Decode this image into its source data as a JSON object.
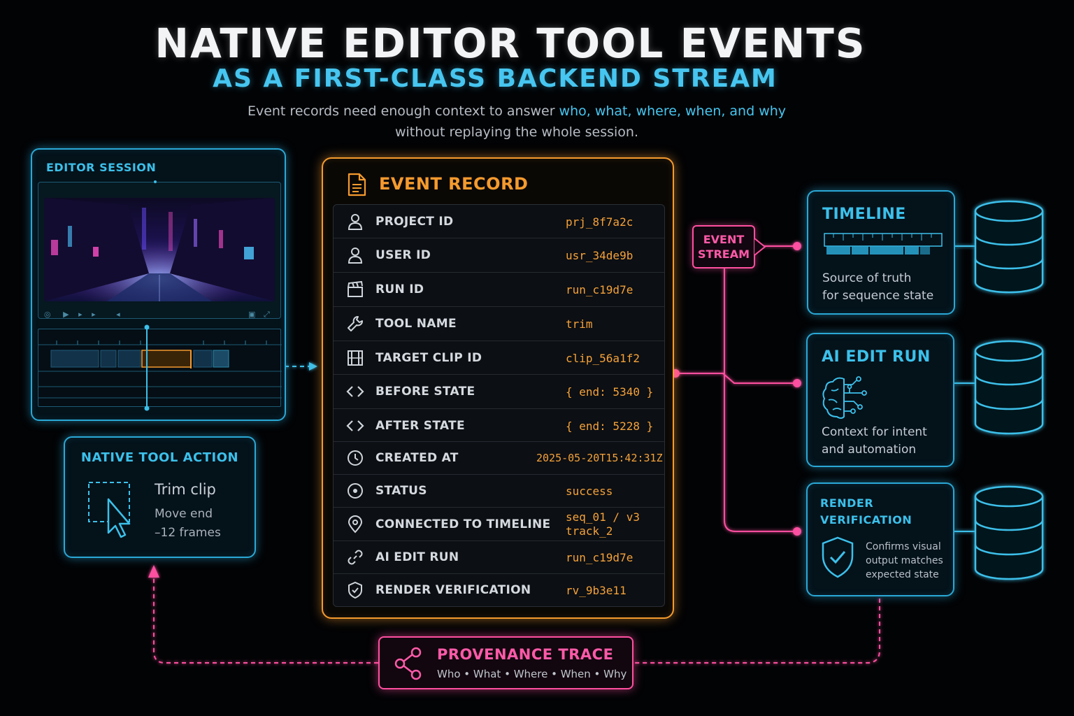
{
  "header": {
    "title": "NATIVE EDITOR TOOL EVENTS",
    "subtitle": "AS A FIRST-CLASS BACKEND STREAM",
    "desc_line1_a": "Event records need enough context to answer ",
    "desc_line1_b": "who, what, where, when, and why",
    "desc_line2": "without replaying the whole session."
  },
  "editor_session": {
    "label": "EDITOR SESSION"
  },
  "native_tool_action": {
    "label": "NATIVE TOOL ACTION",
    "action": "Trim clip",
    "detail_line1": "Move end",
    "detail_line2": "–12 frames"
  },
  "event_record": {
    "title": "EVENT RECORD",
    "rows": [
      {
        "icon": "user-icon",
        "label": "PROJECT ID",
        "value": "prj_8f7a2c"
      },
      {
        "icon": "user-icon",
        "label": "USER ID",
        "value": "usr_34de9b"
      },
      {
        "icon": "clapperboard-icon",
        "label": "RUN ID",
        "value": "run_c19d7e"
      },
      {
        "icon": "wrench-icon",
        "label": "TOOL NAME",
        "value": "trim"
      },
      {
        "icon": "film-icon",
        "label": "TARGET CLIP ID",
        "value": "clip_56a1f2"
      },
      {
        "icon": "code-icon",
        "label": "BEFORE STATE",
        "value": "{ end: 5340 }"
      },
      {
        "icon": "code-icon",
        "label": "AFTER STATE",
        "value": "{ end: 5228 }"
      },
      {
        "icon": "clock-icon",
        "label": "CREATED AT",
        "value": "2025-05-20T15:42:31Z"
      },
      {
        "icon": "status-icon",
        "label": "STATUS",
        "value": "success"
      },
      {
        "icon": "location-pin-icon",
        "label": "CONNECTED TO TIMELINE",
        "value": "seq_01 / v3",
        "value2": "track_2"
      },
      {
        "icon": "link-icon",
        "label": "AI EDIT RUN",
        "value": "run_c19d7e"
      },
      {
        "icon": "shield-check-icon",
        "label": "RENDER VERIFICATION",
        "value": "rv_9b3e11"
      }
    ]
  },
  "event_stream": {
    "line1": "EVENT",
    "line2": "STREAM"
  },
  "targets": {
    "timeline": {
      "title": "TIMELINE",
      "line1": "Source of truth",
      "line2": "for sequence state"
    },
    "ai_edit_run": {
      "title": "AI EDIT RUN",
      "line1": "Context for intent",
      "line2": "and automation"
    },
    "render_verification": {
      "title_line1": "RENDER",
      "title_line2": "VERIFICATION",
      "line1": "Confirms visual",
      "line2": "output matches",
      "line3": "expected state"
    }
  },
  "provenance": {
    "title": "PROVENANCE TRACE",
    "subtitle": "Who • What • Where • When • Why"
  },
  "colors": {
    "cyan": "#2aa8d6",
    "orange": "#f59a2e",
    "pink": "#ff4fa0",
    "background": "#020305"
  }
}
